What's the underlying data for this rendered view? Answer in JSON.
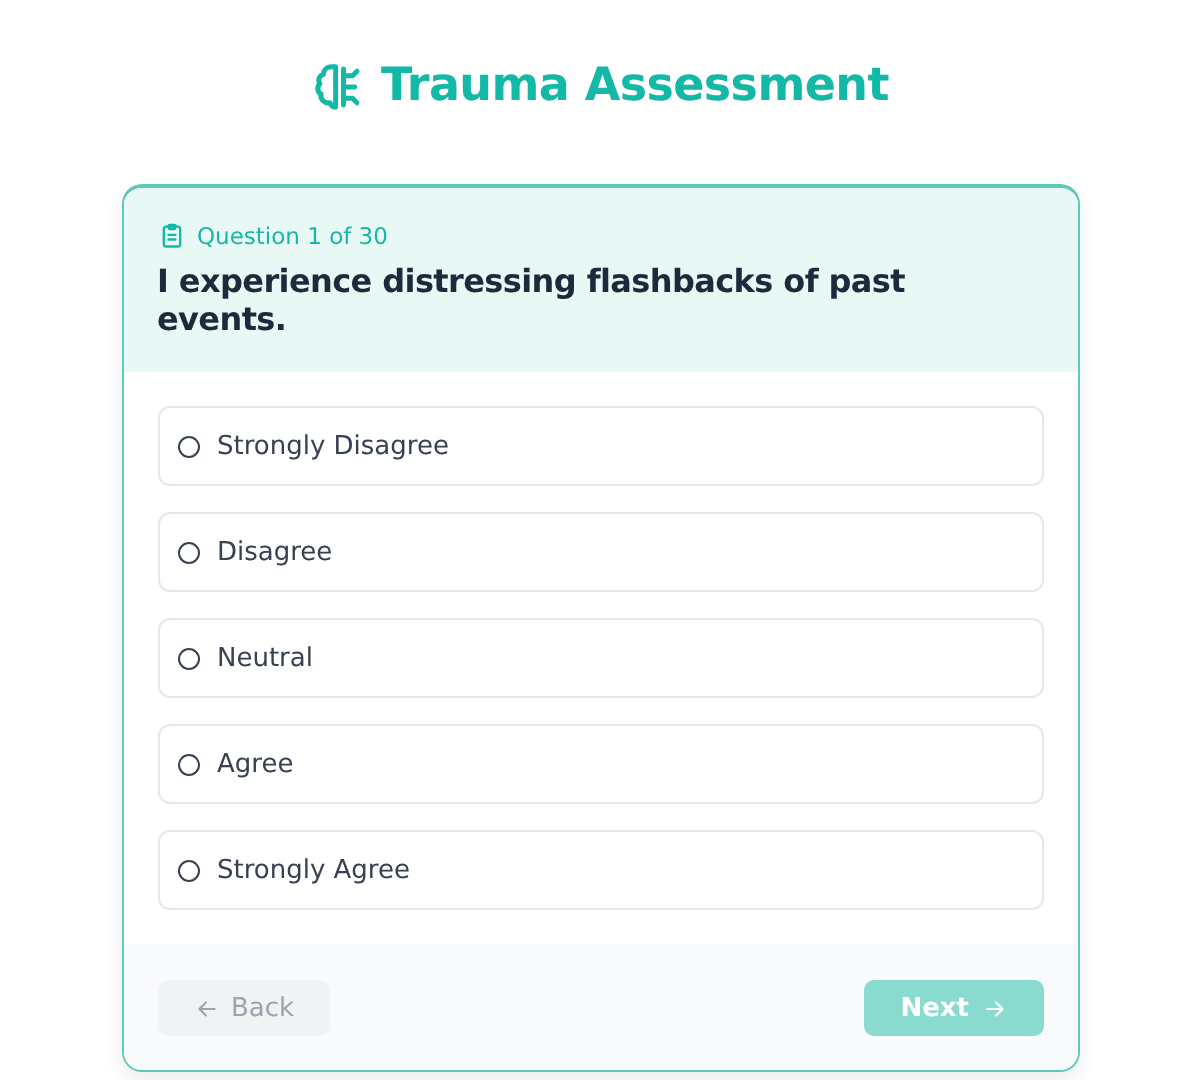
{
  "title": "Trauma Assessment",
  "question": {
    "counter": "Question 1 of 30",
    "text": "I experience distressing flashbacks of past events."
  },
  "options": [
    {
      "label": "Strongly Disagree",
      "selected": false
    },
    {
      "label": "Disagree",
      "selected": false
    },
    {
      "label": "Neutral",
      "selected": false
    },
    {
      "label": "Agree",
      "selected": false
    },
    {
      "label": "Strongly Agree",
      "selected": false
    }
  ],
  "back": {
    "label": "Back",
    "disabled": true
  },
  "next": {
    "label": "Next",
    "disabled": true
  }
}
